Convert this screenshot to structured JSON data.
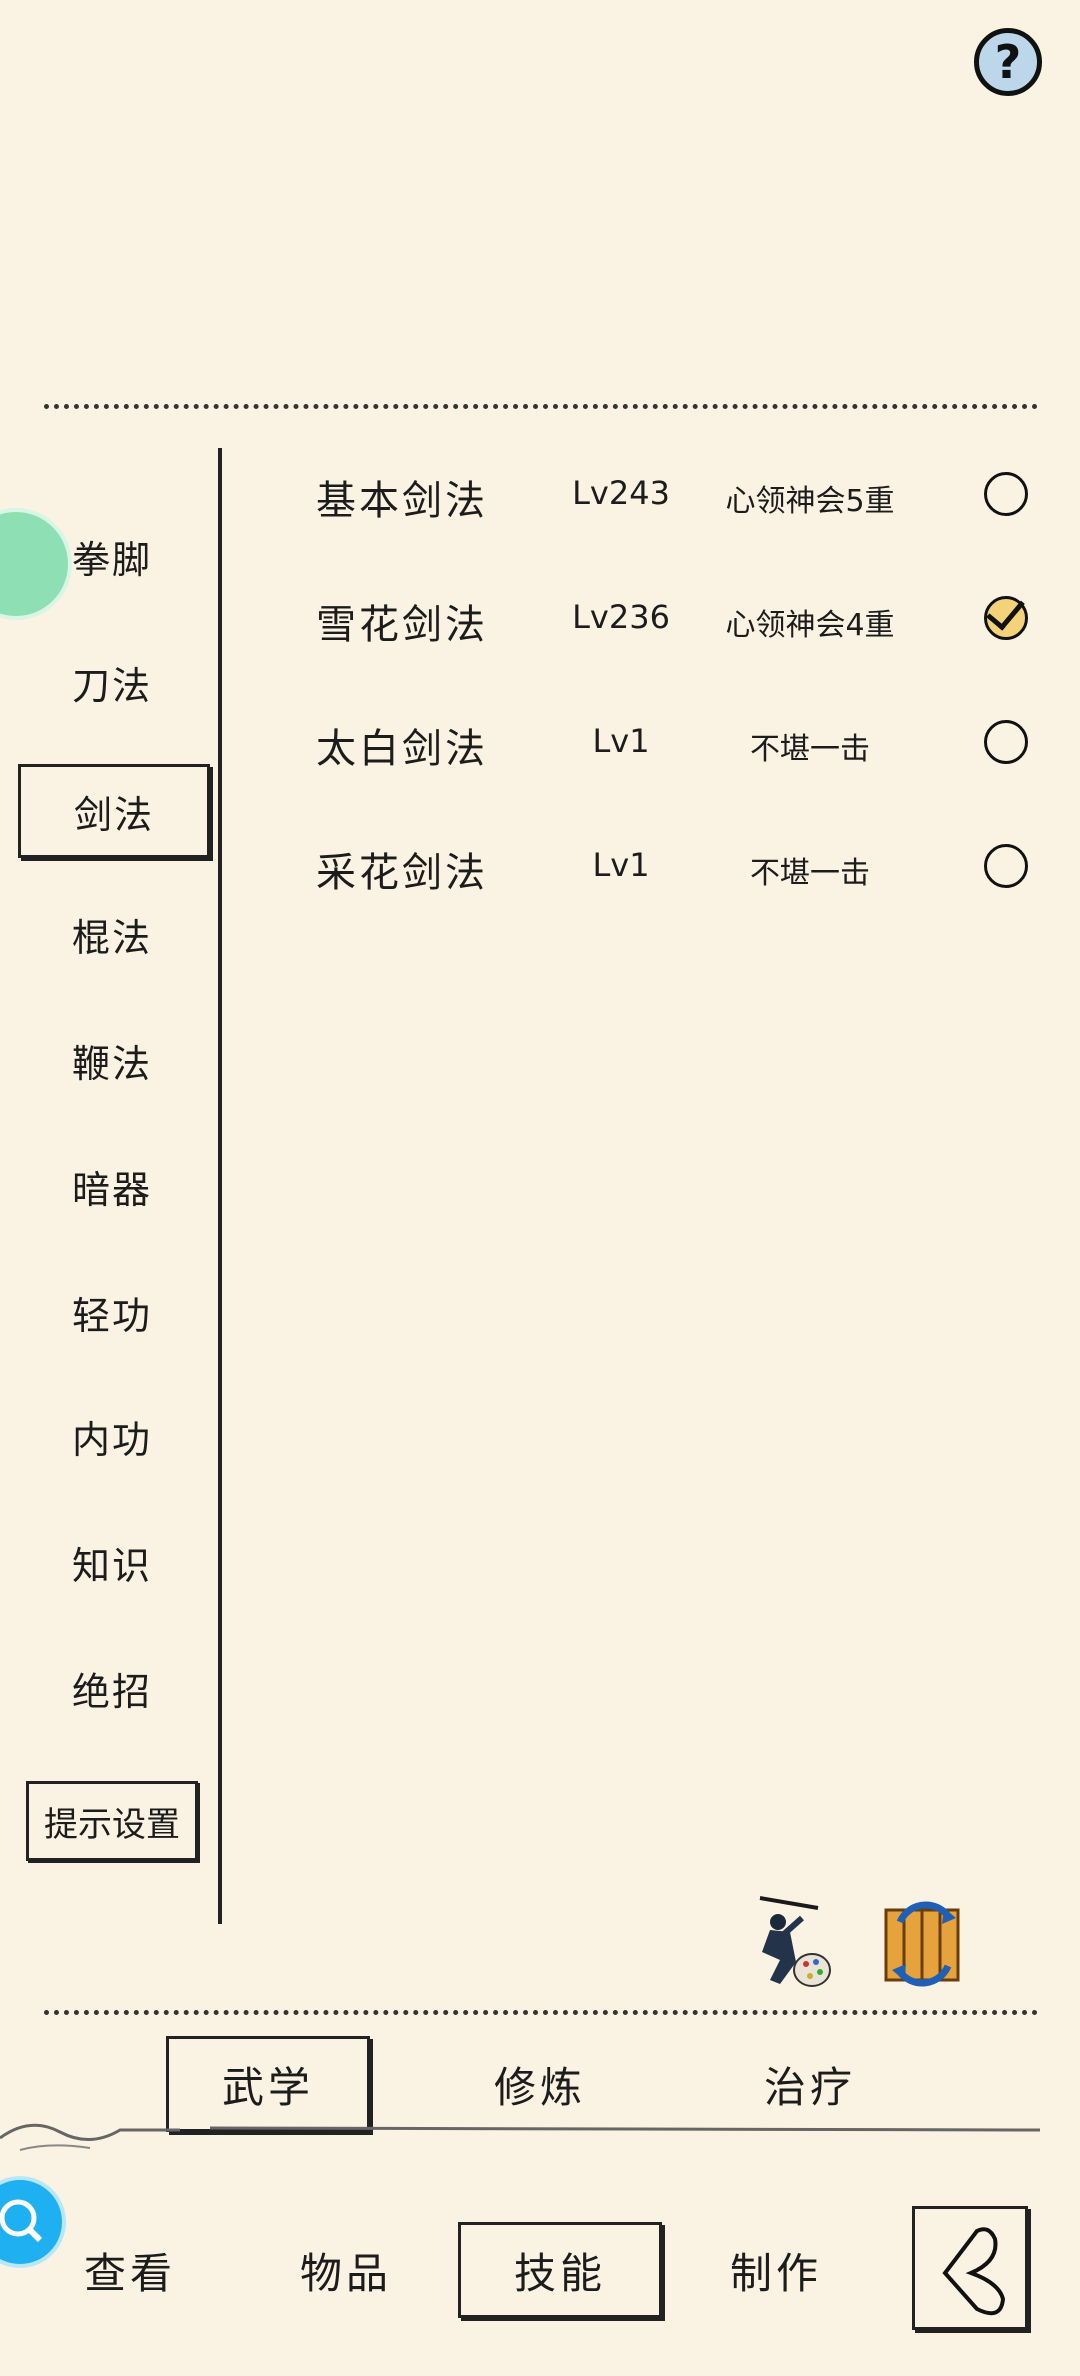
{
  "help": {
    "label": "?"
  },
  "categories": [
    {
      "label": "拳脚",
      "active": false
    },
    {
      "label": "刀法",
      "active": false
    },
    {
      "label": "剑法",
      "active": true
    },
    {
      "label": "棍法",
      "active": false
    },
    {
      "label": "鞭法",
      "active": false
    },
    {
      "label": "暗器",
      "active": false
    },
    {
      "label": "轻功",
      "active": false
    },
    {
      "label": "内功",
      "active": false
    },
    {
      "label": "知识",
      "active": false
    },
    {
      "label": "绝招",
      "active": false
    }
  ],
  "tip_settings_label": "提示设置",
  "skills": [
    {
      "name": "基本剑法",
      "level": "Lv243",
      "rank": "心领神会5重",
      "selected": false
    },
    {
      "name": "雪花剑法",
      "level": "Lv236",
      "rank": "心领神会4重",
      "selected": true
    },
    {
      "name": "太白剑法",
      "level": "Lv1",
      "rank": "不堪一击",
      "selected": false
    },
    {
      "name": "采花剑法",
      "level": "Lv1",
      "rank": "不堪一击",
      "selected": false
    }
  ],
  "sub_tabs": [
    {
      "label": "武学",
      "active": true
    },
    {
      "label": "修炼",
      "active": false
    },
    {
      "label": "治疗",
      "active": false
    }
  ],
  "bottom_nav": [
    {
      "label": "查看",
      "active": false
    },
    {
      "label": "物品",
      "active": false
    },
    {
      "label": "技能",
      "active": true
    },
    {
      "label": "制作",
      "active": false
    }
  ],
  "icons": {
    "help": "question-circle-icon",
    "action_1": "swordsman-palette-icon",
    "action_2": "scroll-swap-icon",
    "search": "search-icon",
    "back": "back-arrow-icon"
  },
  "colors": {
    "background": "#faf3e3",
    "checked_fill": "#f4d27a",
    "help_fill": "#bcd7ea",
    "fab_blue": "#1eb0f0",
    "float_green": "#8ee0b4"
  }
}
